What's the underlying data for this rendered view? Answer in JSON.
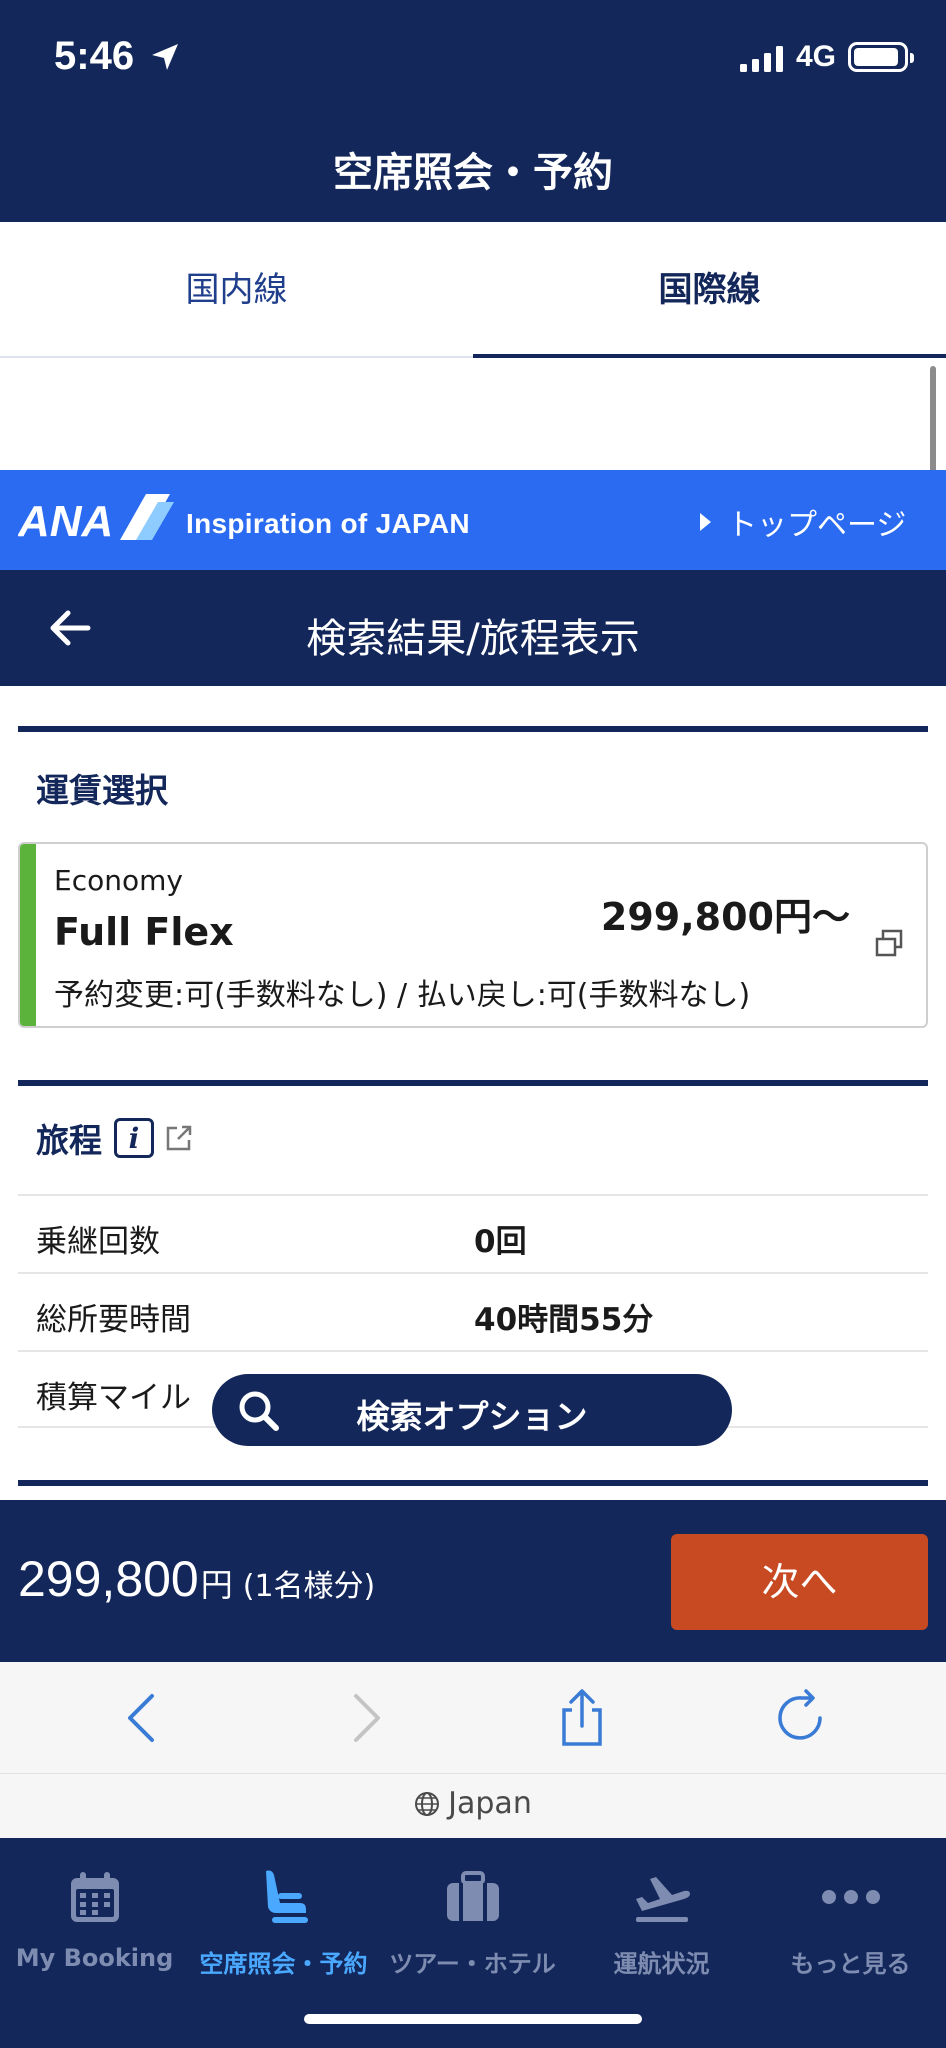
{
  "status_bar": {
    "time": "5:46",
    "network": "4G"
  },
  "app_header": {
    "title": "空席照会・予約"
  },
  "segment_tabs": [
    {
      "label": "国内線",
      "selected": false
    },
    {
      "label": "国際線",
      "selected": true
    }
  ],
  "ana_band": {
    "logo_text": "ANA",
    "tagline": "Inspiration of JAPAN",
    "top_page_link": "トップページ"
  },
  "result_header": {
    "title": "検索結果/旅程表示"
  },
  "fare_section": {
    "title": "運賃選択",
    "cabin": "Economy",
    "fare_name": "Full Flex",
    "price": "299,800円〜",
    "conditions": "予約変更:可(手数料なし) / 払い戻し:可(手数料なし)"
  },
  "itinerary_section": {
    "title": "旅程",
    "rows": [
      {
        "label": "乗継回数",
        "value": "0回"
      },
      {
        "label": "総所要時間",
        "value": "40時間55分"
      },
      {
        "label": "積算マイル",
        "value": ""
      }
    ]
  },
  "search_option_button": {
    "label": "検索オプション"
  },
  "footer": {
    "amount": "299,800",
    "unit": "円",
    "note": "(1名様分)",
    "next_label": "次へ"
  },
  "browser": {
    "domain": "Japan"
  },
  "tabbar": [
    {
      "label": "My Booking",
      "icon": "calendar-icon",
      "active": false
    },
    {
      "label": "空席照会・予約",
      "icon": "seat-icon",
      "active": true
    },
    {
      "label": "ツアー・ホテル",
      "icon": "suitcase-icon",
      "active": false
    },
    {
      "label": "運航状況",
      "icon": "plane-departure-icon",
      "active": false
    },
    {
      "label": "もっと見る",
      "icon": "more-icon",
      "active": false
    }
  ],
  "colors": {
    "navy": "#13275a",
    "ana_blue": "#2a6bf1",
    "next_orange": "#c84a22",
    "fare_accent": "#5cb33b",
    "tab_active": "#4aa8ff"
  }
}
